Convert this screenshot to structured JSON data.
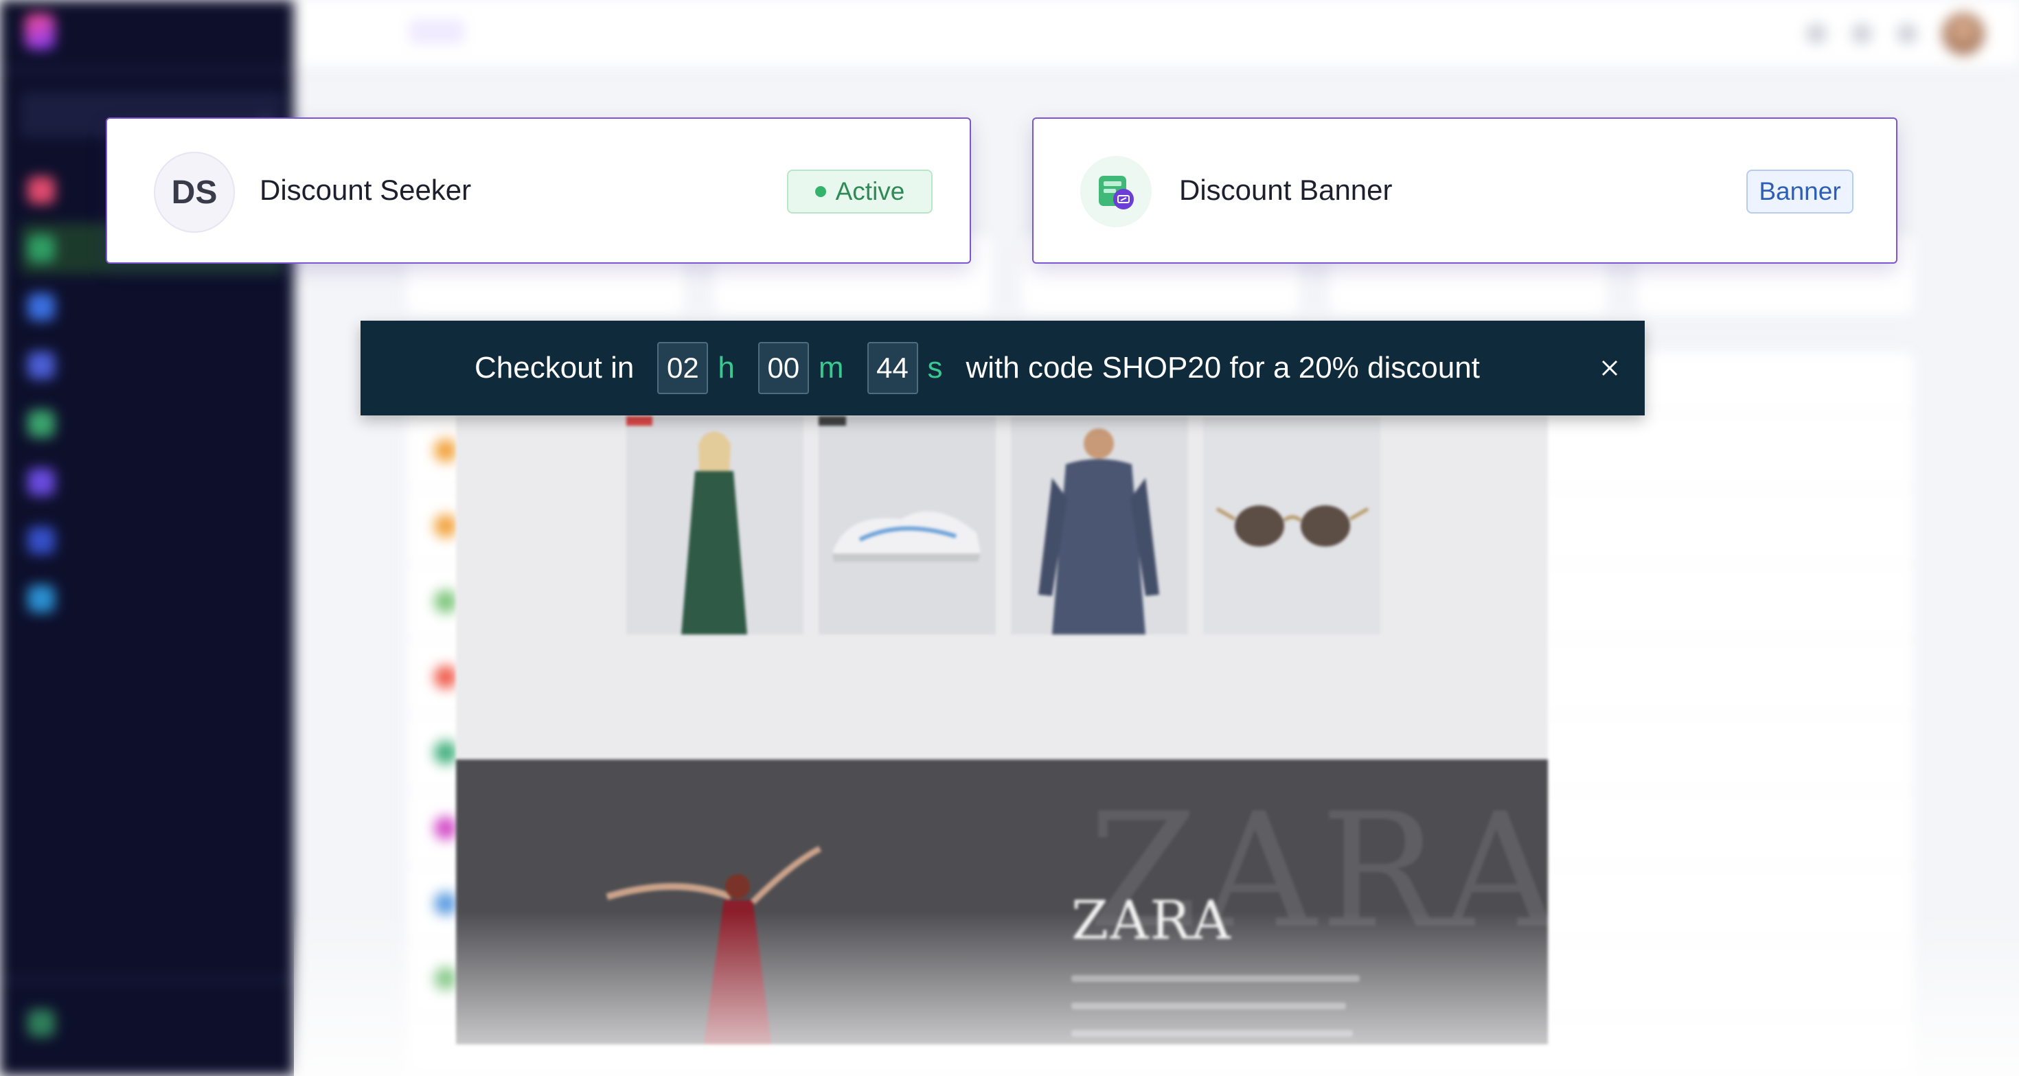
{
  "seeker_card": {
    "initials": "DS",
    "title": "Discount Seeker",
    "status": "Active",
    "status_color": "#34b36b"
  },
  "banner_card": {
    "icon": "coupon-banner-icon",
    "title": "Discount Banner",
    "type": "Banner",
    "type_color": "#2d5fb8"
  },
  "countdown_bar": {
    "prefix": "Checkout in",
    "hours": "02",
    "hours_unit": "h",
    "minutes": "00",
    "minutes_unit": "m",
    "seconds": "44",
    "seconds_unit": "s",
    "suffix": "with code SHOP20 for a 20% discount",
    "close_icon": "close-icon",
    "bg_color": "#0f2a3b",
    "accent_color": "#37c98f"
  },
  "preview": {
    "logo": "ZARA"
  }
}
